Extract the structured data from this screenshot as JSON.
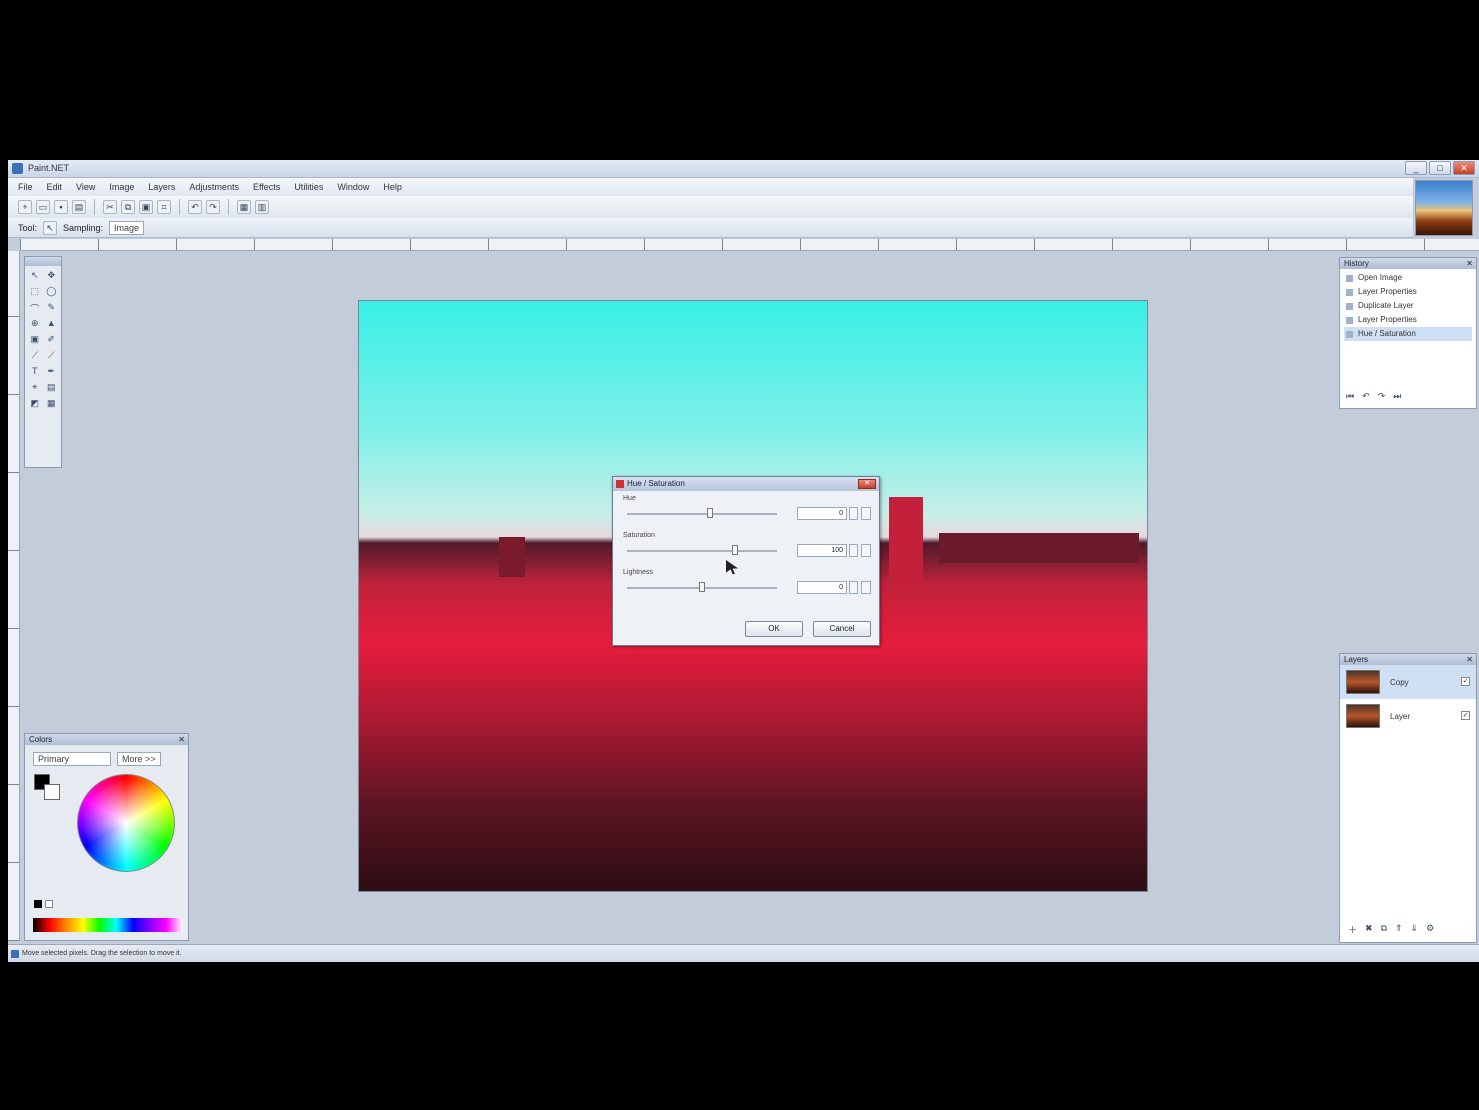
{
  "window": {
    "title": "Paint.NET",
    "minimize": "_",
    "maximize": "□",
    "close": "✕"
  },
  "menu": [
    "File",
    "Edit",
    "View",
    "Image",
    "Layers",
    "Adjustments",
    "Effects",
    "Utilities",
    "Window",
    "Help"
  ],
  "toolbar2": {
    "tool_label": "Tool:",
    "sampling": "Sampling:",
    "mode": "Image"
  },
  "tools": {
    "icons": [
      "↖",
      "✥",
      "⬚",
      "◯",
      "⌒",
      "✎",
      "⊕",
      "▲",
      "▣",
      "✐",
      "⟋",
      "⟋",
      "T",
      "✒",
      "⌖",
      "▤",
      "◩",
      "▦"
    ]
  },
  "colors": {
    "title": "Colors",
    "mode": "Primary",
    "more": "More >>"
  },
  "history": {
    "title": "History",
    "items": [
      "Open Image",
      "Layer Properties",
      "Duplicate Layer",
      "Layer Properties",
      "Hue / Saturation"
    ],
    "buttons": [
      "⏮",
      "↶",
      "↷",
      "⏭"
    ]
  },
  "layers": {
    "title": "Layers",
    "items": [
      {
        "name": "Copy",
        "checked": "✓"
      },
      {
        "name": "Layer",
        "checked": "✓"
      }
    ],
    "buttons": [
      "＋",
      "✖",
      "⧉",
      "⇑",
      "⇓",
      "⚙"
    ]
  },
  "dialog": {
    "title": "Hue / Saturation",
    "rows": [
      {
        "label": "Hue",
        "value": "0",
        "knob": 0.55
      },
      {
        "label": "Saturation",
        "value": "100",
        "knob": 0.72
      },
      {
        "label": "Lightness",
        "value": "0",
        "knob": 0.5
      }
    ],
    "ok": "OK",
    "cancel": "Cancel"
  },
  "statusbar": {
    "hint": "Move selected pixels. Drag the selection to move it.",
    "zoom": "",
    "coords": ""
  }
}
